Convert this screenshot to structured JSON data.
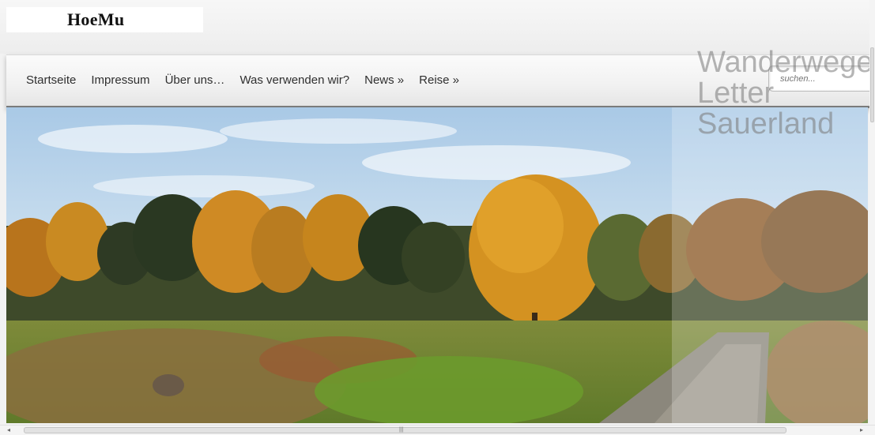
{
  "site": {
    "logo": "HoeMu"
  },
  "nav": {
    "items": [
      {
        "label": "Startseite"
      },
      {
        "label": "Impressum"
      },
      {
        "label": "Über uns…"
      },
      {
        "label": "Was verwenden wir?"
      },
      {
        "label": "News »"
      },
      {
        "label": "Reise »"
      }
    ]
  },
  "search": {
    "placeholder": "suchen..."
  },
  "hero": {
    "caption_lines": [
      "Wanderwege",
      "Letter",
      "Sauerland"
    ],
    "colors": {
      "sky": "#bcd6ec",
      "foliage": "#d08a1c",
      "grass": "#7a9a3a",
      "path": "#8e8a80"
    }
  },
  "scrollbar": {
    "grip": "|||"
  }
}
